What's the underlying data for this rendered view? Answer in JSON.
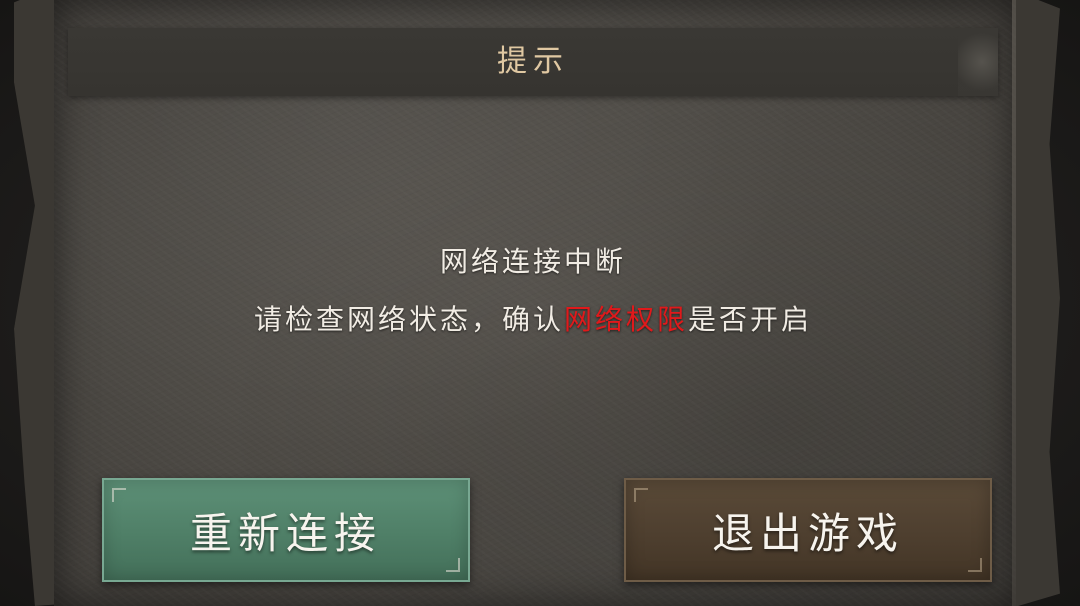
{
  "dialog": {
    "title": "提示",
    "message_line1": "网络连接中断",
    "message_line2_before": "请检查网络状态，确认",
    "message_line2_highlight": "网络权限",
    "message_line2_after": "是否开启"
  },
  "buttons": {
    "reconnect_label": "重新连接",
    "exit_label": "退出游戏"
  },
  "colors": {
    "highlight": "#e0191b",
    "reconnect_button": "#4f7f67",
    "exit_button": "#4e3f2f",
    "title_text": "#e0c8a2"
  }
}
